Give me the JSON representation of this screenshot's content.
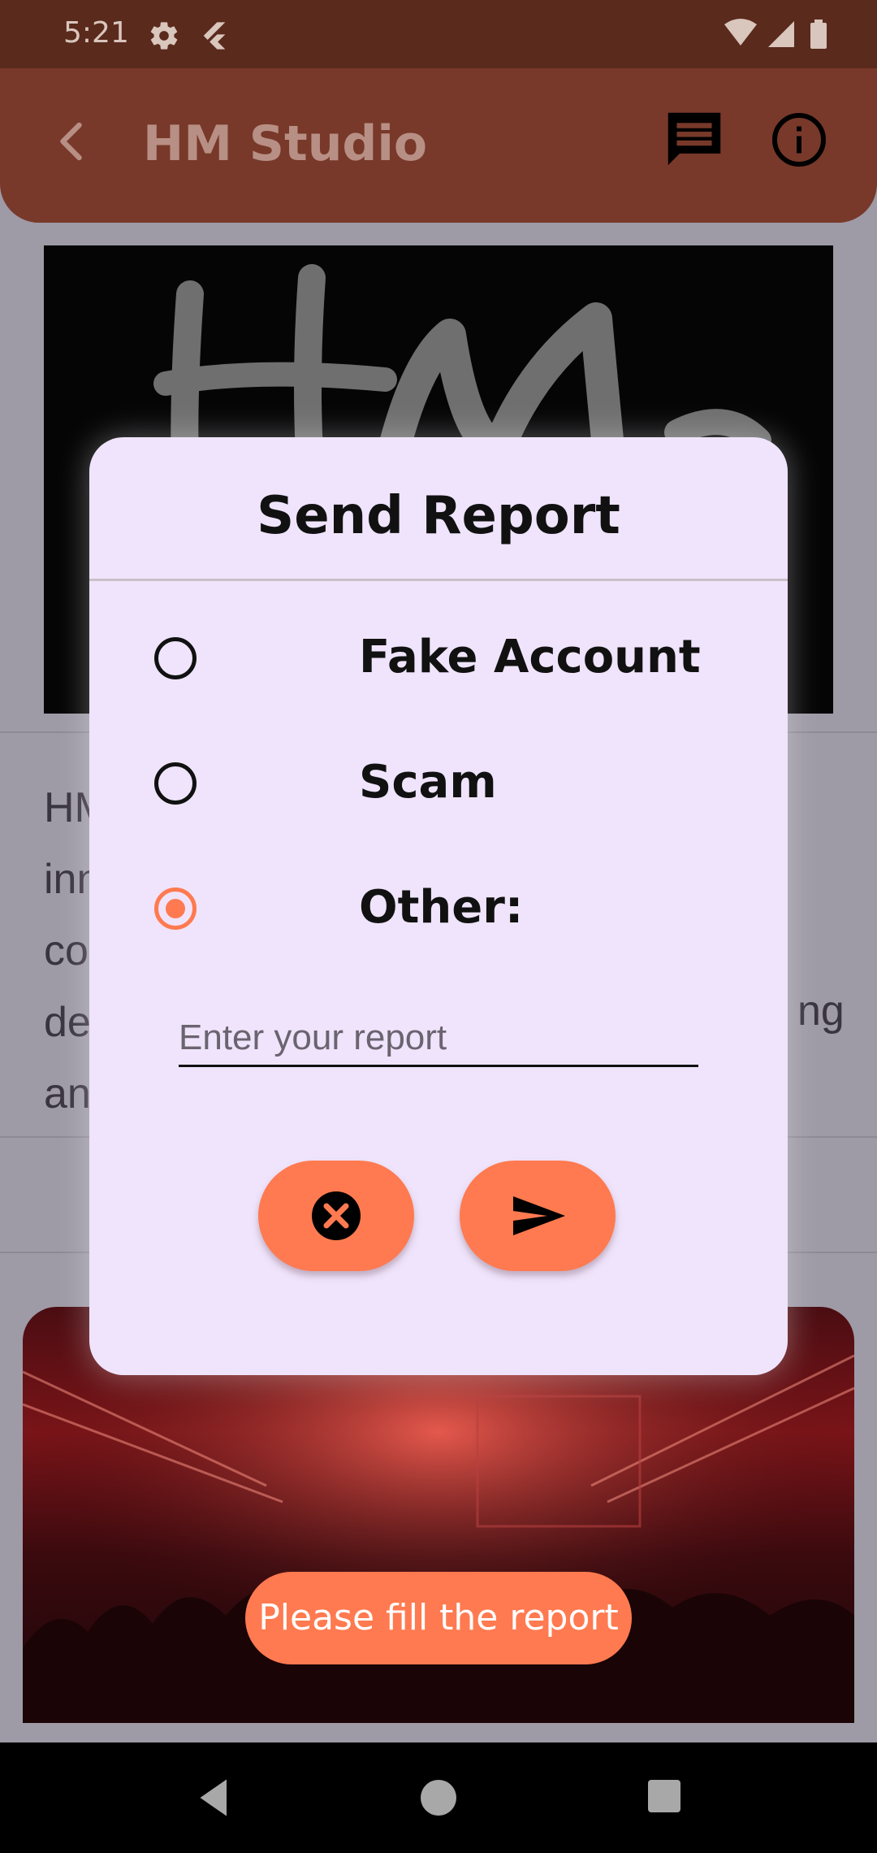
{
  "status_bar": {
    "time": "5:21"
  },
  "app_bar": {
    "title": "HM Studio"
  },
  "background": {
    "description_lines": [
      "HM",
      "inn",
      "co",
      "de",
      "an"
    ],
    "description_tail": "ng"
  },
  "dialog": {
    "title": "Send Report",
    "options": [
      {
        "label": "Fake Account",
        "selected": false
      },
      {
        "label": "Scam",
        "selected": false
      },
      {
        "label": "Other:",
        "selected": true
      }
    ],
    "input": {
      "value": "",
      "placeholder": "Enter your report"
    }
  },
  "toast": {
    "message": "Please fill the report"
  },
  "colors": {
    "accent": "#ff7a50",
    "app_bar": "#78392a",
    "status_bar": "#5a2a1c",
    "dialog_bg": "#efe4fb"
  },
  "icons": {
    "cancel": "close-circle-icon",
    "send": "send-icon",
    "chat": "chat-icon",
    "info": "info-icon",
    "back": "chevron-left-icon"
  }
}
